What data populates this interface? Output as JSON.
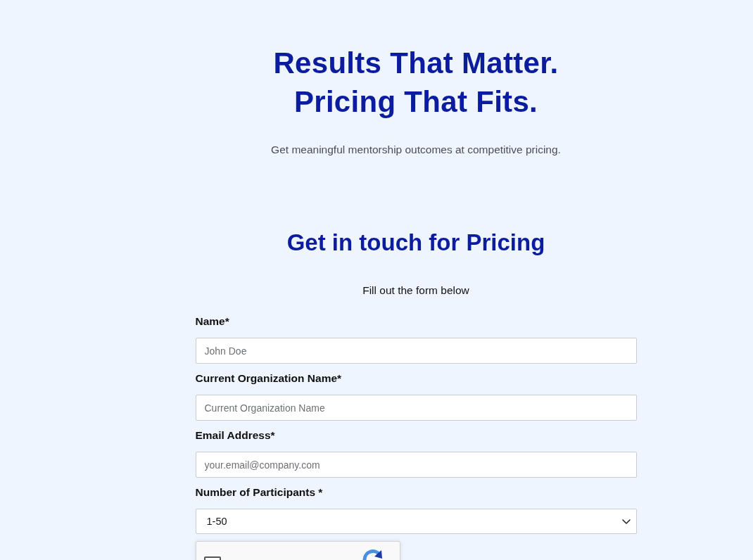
{
  "hero": {
    "title_lines": [
      "Results That Matter.",
      "Pricing That Fits."
    ],
    "subtitle": "Get meaningful mentorship outcomes at competitive pricing."
  },
  "contact": {
    "title": "Get in touch for Pricing",
    "intro": "Fill out the form below",
    "fields": [
      {
        "kind": "text",
        "label": "Name*",
        "placeholder": "John Doe"
      },
      {
        "kind": "text",
        "label": "Current Organization Name*",
        "placeholder": "Current Organization Name"
      },
      {
        "kind": "text",
        "label": "Email Address*",
        "placeholder": "your.email@company.com"
      },
      {
        "kind": "select",
        "label": "Number of Participants *",
        "value": "1-50"
      }
    ],
    "captcha": {
      "checked": false
    }
  }
}
